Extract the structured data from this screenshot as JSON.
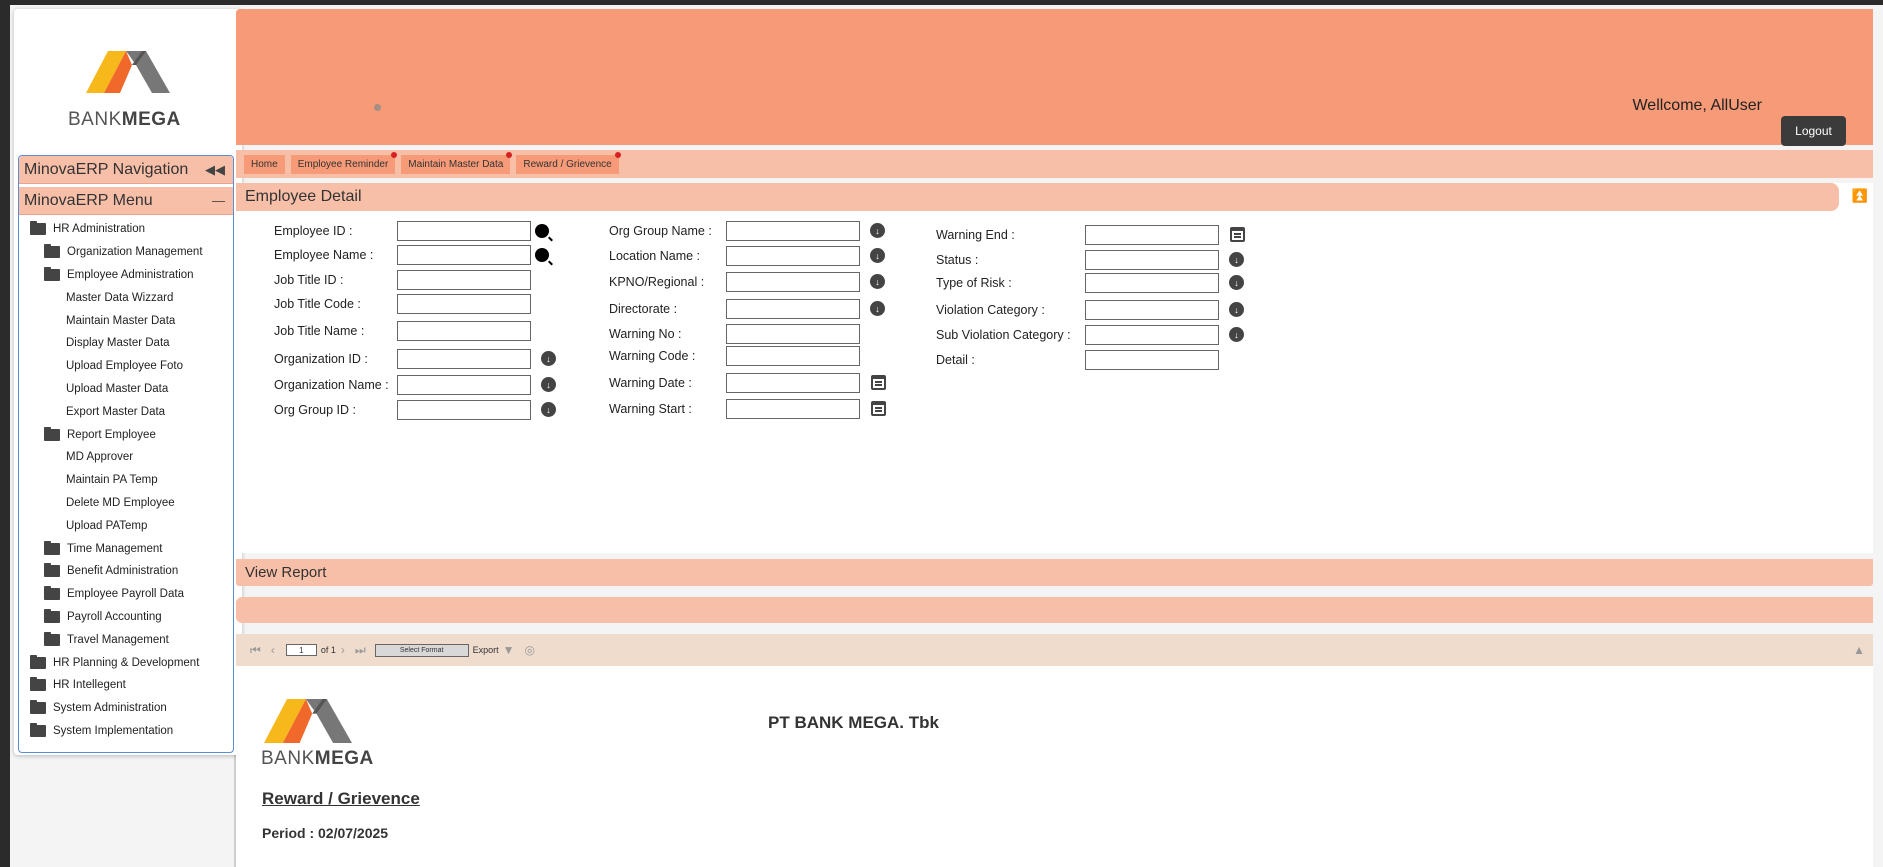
{
  "brand": {
    "logo_text_left": "BANK",
    "logo_text_right": "MEGA",
    "colors": {
      "yellow": "#f6b81a",
      "orange": "#f0682a",
      "gray": "#777777"
    }
  },
  "nav": {
    "title": "MinovaERP Navigation",
    "collapse_icon": "double-chevron-left-icon",
    "menu_title": "MinovaERP Menu",
    "menu_icon": "minus-icon",
    "items": [
      {
        "label": "HR Administration",
        "level": 0,
        "folder": true
      },
      {
        "label": "Organization Management",
        "level": 1,
        "folder": true
      },
      {
        "label": "Employee Administration",
        "level": 1,
        "folder": true
      },
      {
        "label": "Master Data Wizzard",
        "level": 2,
        "folder": false
      },
      {
        "label": "Maintain Master Data",
        "level": 2,
        "folder": false
      },
      {
        "label": "Display Master Data",
        "level": 2,
        "folder": false
      },
      {
        "label": "Upload Employee Foto",
        "level": 2,
        "folder": false
      },
      {
        "label": "Upload Master Data",
        "level": 2,
        "folder": false
      },
      {
        "label": "Export Master Data",
        "level": 2,
        "folder": false
      },
      {
        "label": "Report Employee",
        "level": 1,
        "folder": true
      },
      {
        "label": "MD Approver",
        "level": 2,
        "folder": false
      },
      {
        "label": "Maintain PA Temp",
        "level": 2,
        "folder": false
      },
      {
        "label": "Delete MD Employee",
        "level": 2,
        "folder": false
      },
      {
        "label": "Upload PATemp",
        "level": 2,
        "folder": false
      },
      {
        "label": "Time Management",
        "level": 1,
        "folder": true
      },
      {
        "label": "Benefit Administration",
        "level": 1,
        "folder": true
      },
      {
        "label": "Employee Payroll Data",
        "level": 1,
        "folder": true
      },
      {
        "label": "Payroll Accounting",
        "level": 1,
        "folder": true
      },
      {
        "label": "Travel Management",
        "level": 1,
        "folder": true
      },
      {
        "label": "HR Planning & Development",
        "level": 0,
        "folder": true
      },
      {
        "label": "HR Intellegent",
        "level": 0,
        "folder": true
      },
      {
        "label": "System Administration",
        "level": 0,
        "folder": true
      },
      {
        "label": "System Implementation",
        "level": 0,
        "folder": true
      }
    ]
  },
  "header": {
    "welcome": "Wellcome, AllUser",
    "logout": "Logout",
    "background": "#f79a78"
  },
  "tabs": [
    {
      "label": "Home",
      "badge": false
    },
    {
      "label": "Employee Reminder",
      "badge": true
    },
    {
      "label": "Maintain Master Data",
      "badge": true
    },
    {
      "label": "Reward / Grievence",
      "badge": true
    }
  ],
  "detail": {
    "title": "Employee Detail",
    "collapse_icon": "collapse-up-icon",
    "col1": [
      {
        "label": "Employee ID :",
        "value": "",
        "icon": "search-icon"
      },
      {
        "label": "Employee Name :",
        "value": "",
        "icon": "search-icon"
      },
      {
        "label": "Job Title ID :",
        "value": "",
        "icon": ""
      },
      {
        "label": "Job Title Code :",
        "value": "",
        "icon": ""
      },
      {
        "label": "Job Title Name :",
        "value": "",
        "icon": ""
      },
      {
        "label": "Organization ID :",
        "value": "",
        "icon": "dropdown-icon"
      },
      {
        "label": "Organization Name :",
        "value": "",
        "icon": "dropdown-icon"
      },
      {
        "label": "Org Group ID :",
        "value": "",
        "icon": "dropdown-icon"
      }
    ],
    "col2": [
      {
        "label": "Org Group Name :",
        "value": "",
        "icon": "dropdown-icon"
      },
      {
        "label": "Location Name :",
        "value": "",
        "icon": "dropdown-icon"
      },
      {
        "label": "KPNO/Regional :",
        "value": "",
        "icon": "dropdown-icon"
      },
      {
        "label": "Directorate :",
        "value": "",
        "icon": "dropdown-icon"
      },
      {
        "label": "Warning No :",
        "value": "",
        "icon": ""
      },
      {
        "label": "Warning Code :",
        "value": "",
        "icon": ""
      },
      {
        "label": "Warning Date :",
        "value": "",
        "icon": "calendar-icon"
      },
      {
        "label": "Warning Start :",
        "value": "",
        "icon": "calendar-icon"
      }
    ],
    "col3": [
      {
        "label": "Warning End :",
        "value": "",
        "icon": "calendar-icon"
      },
      {
        "label": "Status :",
        "value": "",
        "icon": "dropdown-icon"
      },
      {
        "label": "Type of Risk :",
        "value": "",
        "icon": "dropdown-icon"
      },
      {
        "label": "Violation Category :",
        "value": "",
        "icon": "dropdown-icon"
      },
      {
        "label": "Sub Violation Category :",
        "value": "",
        "icon": "dropdown-icon"
      },
      {
        "label": "Detail :",
        "value": "",
        "icon": ""
      }
    ]
  },
  "report": {
    "section_title": "View Report",
    "toolbar": {
      "page": "1",
      "of": "of 1",
      "format": "Select Format",
      "export": "Export"
    },
    "company": "PT BANK MEGA. Tbk",
    "title": "Reward / Grievence",
    "period": "Period : 02/07/2025"
  }
}
